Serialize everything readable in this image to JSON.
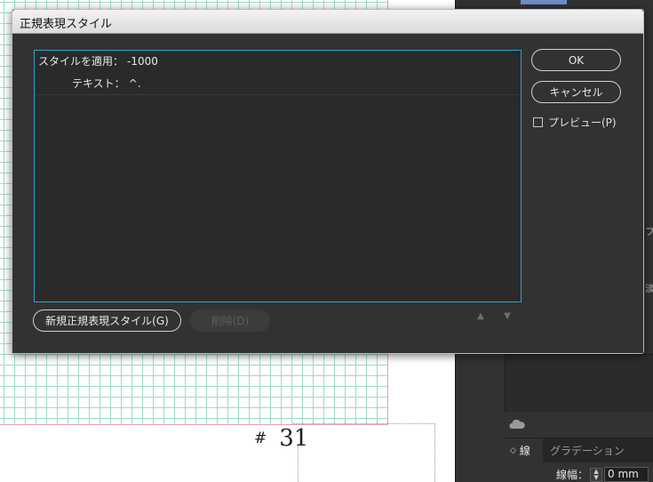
{
  "dialog": {
    "title": "正規表現スタイル",
    "list": [
      {
        "label": "スタイルを適用：",
        "value": "-1000"
      },
      {
        "label": "テキスト：",
        "value": "^."
      }
    ],
    "buttons": {
      "ok": "OK",
      "cancel": "キャンセル",
      "new_style": "新規正規表現スタイル(G)",
      "delete": "削除(D)"
    },
    "preview": {
      "label": "プレビュー(P)",
      "checked": false
    },
    "move_up_glyph": "▲",
    "move_down_glyph": "▼",
    "accent_color": "#2f9fd1"
  },
  "document": {
    "page_marker": "#",
    "page_number": "31",
    "grid_color": "#9fdcc6",
    "margin_color": "#e6a0c8"
  },
  "panel": {
    "tabs": [
      "線",
      "グラデーション"
    ],
    "active_tab": "線",
    "stroke_width_label": "線幅：",
    "stroke_width_value": "0 mm",
    "edge_glyphs": [
      "フ",
      "淡"
    ],
    "icons": [
      "creative-cloud-icon",
      "stepper-icon",
      "tab-collapse-icon"
    ]
  }
}
